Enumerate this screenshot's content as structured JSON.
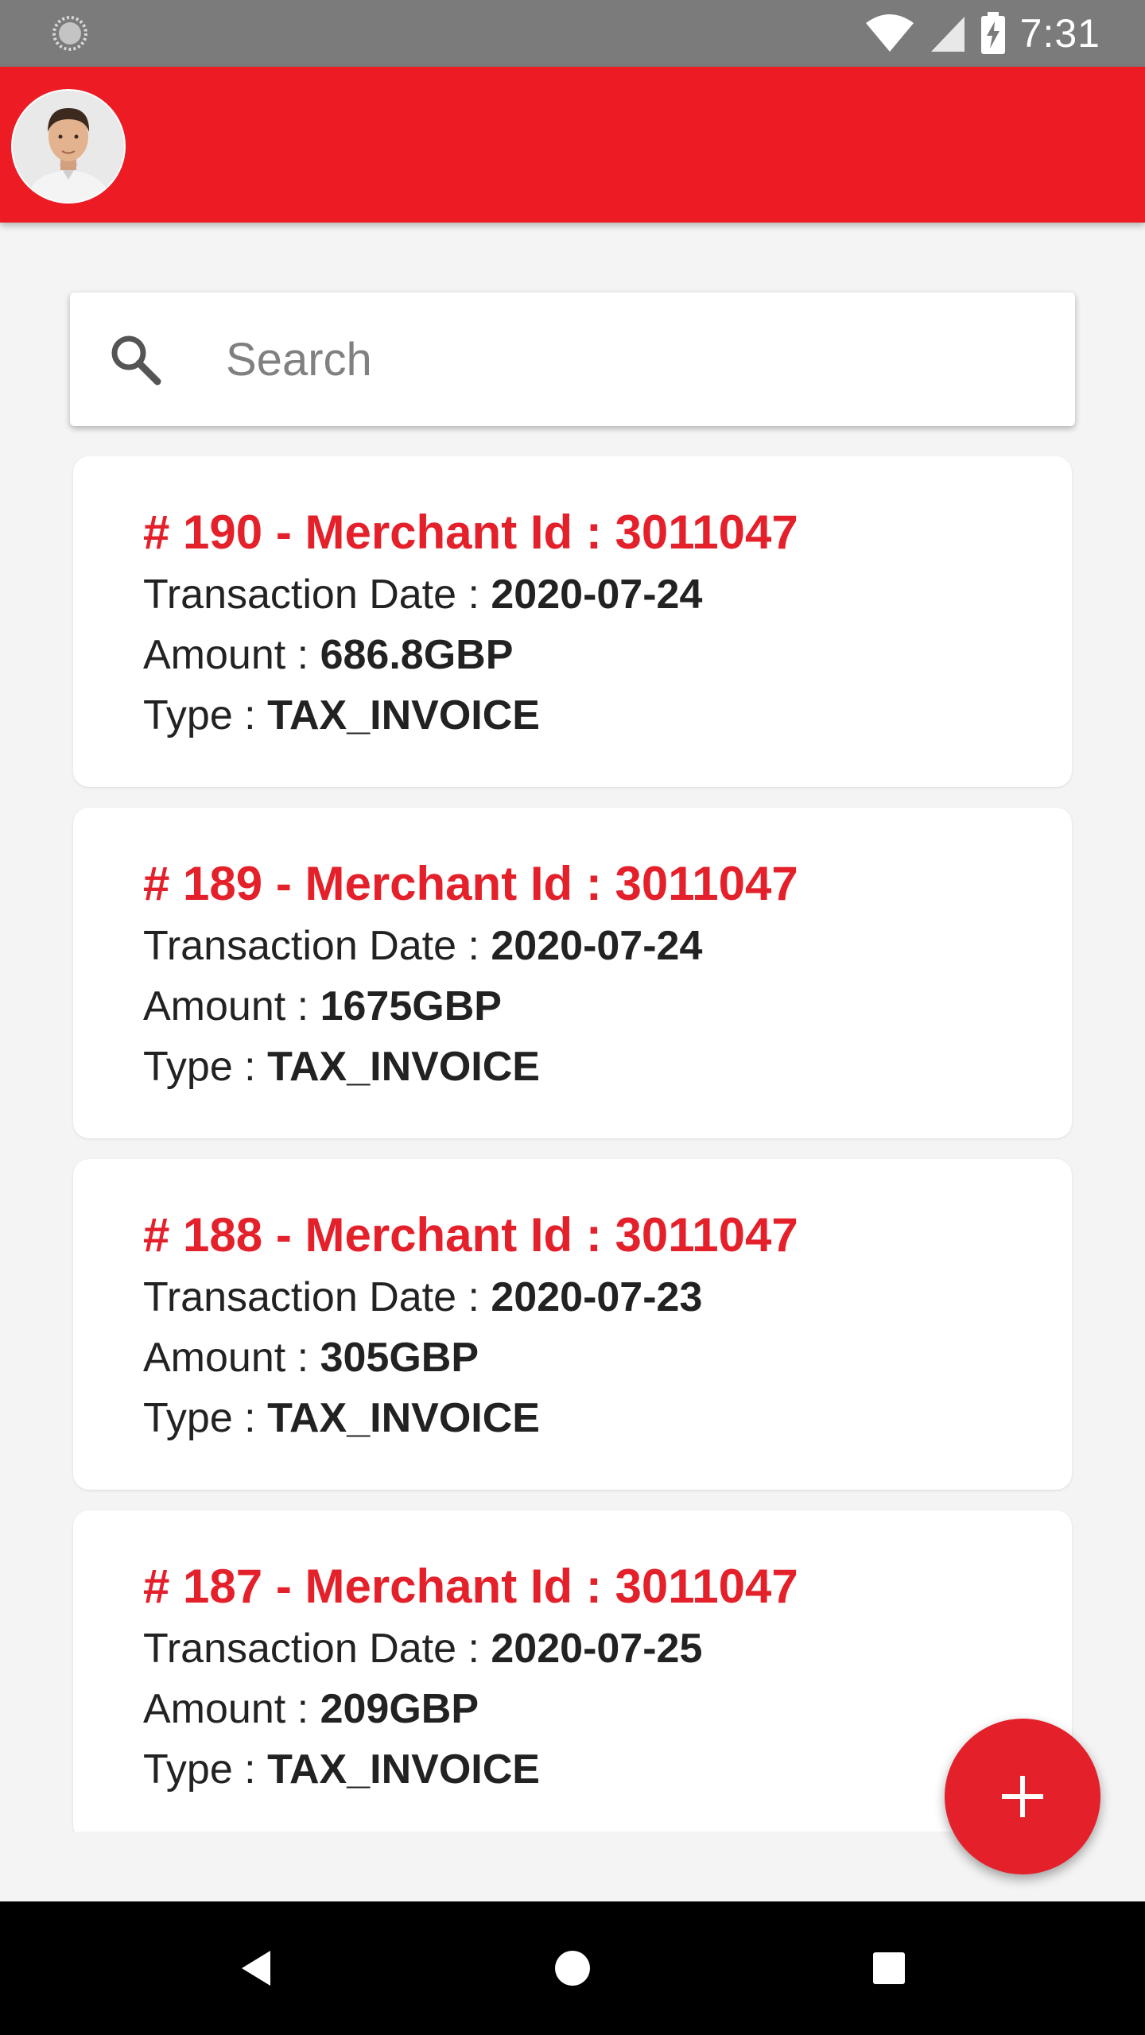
{
  "status_bar": {
    "time": "7:31",
    "icons": [
      "loading-icon",
      "wifi-icon",
      "cell-signal-icon",
      "battery-charging-icon"
    ]
  },
  "app_bar": {
    "avatar_icon": "user-avatar",
    "color": "#ed1c24"
  },
  "search": {
    "placeholder": "Search",
    "value": "",
    "icon": "search-icon"
  },
  "labels": {
    "date": "Transaction Date :",
    "amount": "Amount :",
    "type": "Type :"
  },
  "transactions": [
    {
      "title": "# 190 - Merchant Id : 3011047",
      "date": "2020-07-24",
      "amount": "686.8GBP",
      "type": "TAX_INVOICE"
    },
    {
      "title": "# 189 - Merchant Id : 3011047",
      "date": "2020-07-24",
      "amount": "1675GBP",
      "type": "TAX_INVOICE"
    },
    {
      "title": "# 188 - Merchant Id : 3011047",
      "date": "2020-07-23",
      "amount": "305GBP",
      "type": "TAX_INVOICE"
    },
    {
      "title": "# 187 - Merchant Id : 3011047",
      "date": "2020-07-25",
      "amount": "209GBP",
      "type": "TAX_INVOICE"
    }
  ],
  "fab": {
    "icon": "plus-icon",
    "color": "#e4202a"
  },
  "nav_bar": {
    "icons": [
      "back-icon",
      "home-icon",
      "recents-icon"
    ]
  },
  "colors": {
    "accent": "#ed1c24",
    "title_text": "#e4202a",
    "status_bar": "#7b7b7b",
    "background": "#f4f4f4"
  }
}
